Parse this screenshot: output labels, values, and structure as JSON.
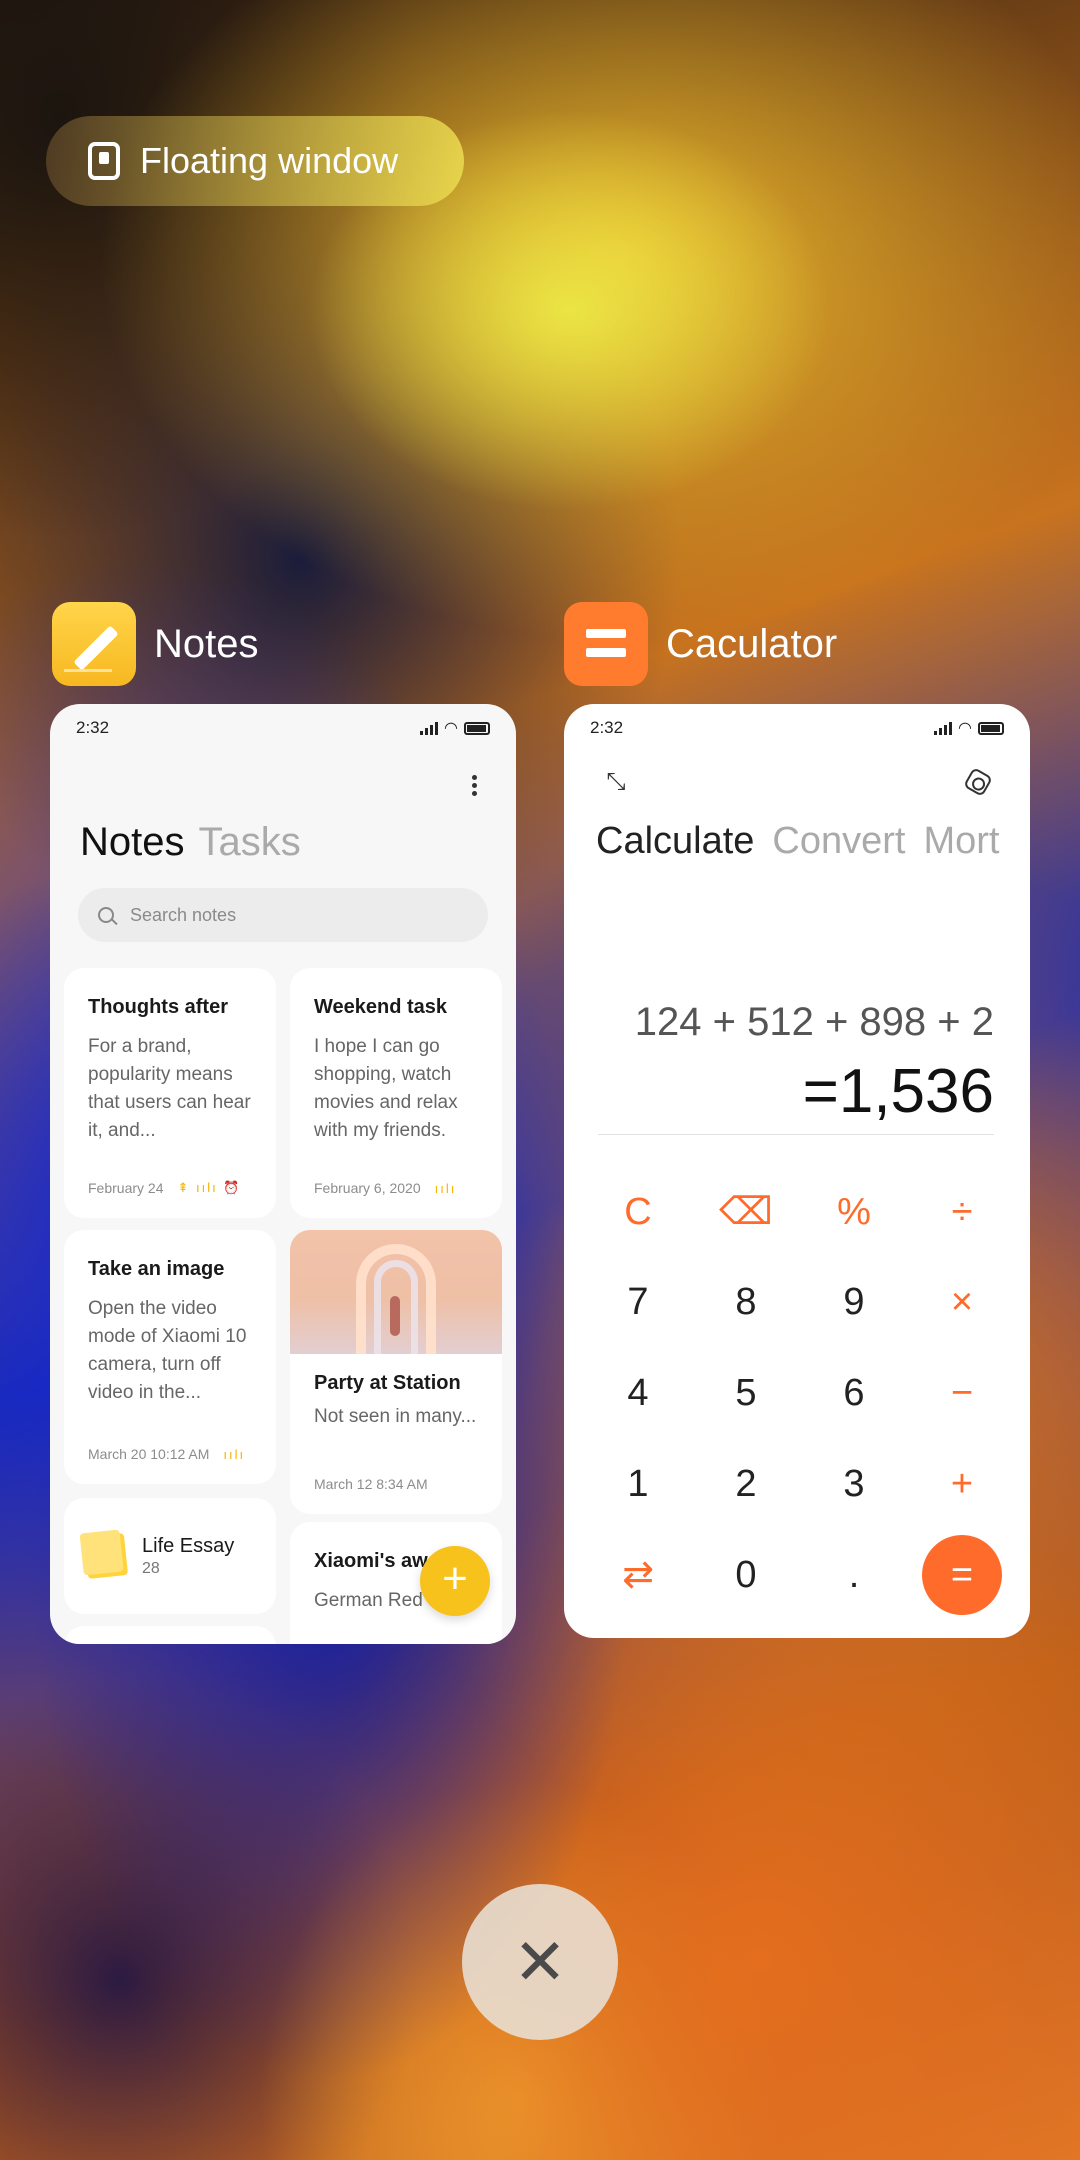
{
  "floating_window": {
    "label": "Floating window",
    "icon": "floating-window-icon"
  },
  "notes_app": {
    "name": "Notes",
    "icon": "notes-app-icon",
    "status_time": "2:32",
    "tabs": [
      "Notes",
      "Tasks"
    ],
    "search_placeholder": "Search notes",
    "notes": [
      {
        "title": "Thoughts after",
        "body": "For a brand, popularity means that users can hear it, and...",
        "date": "February 24"
      },
      {
        "title": "Weekend task",
        "body": "I hope I can go shopping, watch movies and relax with my friends.",
        "date": "February 6, 2020"
      },
      {
        "title": "Take an image",
        "body": "Open the video mode of Xiaomi 10 camera, turn off video in the...",
        "date": "March 20 10:12 AM"
      },
      {
        "title": "Party at Station",
        "body": "Not seen in many...",
        "date": "March 12 8:34 AM"
      },
      {
        "title": "Xiaomi's aw",
        "body": "German Red"
      }
    ],
    "folder": {
      "title": "Life Essay",
      "count": "28"
    },
    "fab_label": "+"
  },
  "calculator_app": {
    "name": "Caculator",
    "icon": "calculator-app-icon",
    "status_time": "2:32",
    "tabs": [
      "Calculate",
      "Convert",
      "Mort"
    ],
    "expression": "124 + 512 + 898 + 2",
    "result": "=1,536",
    "keys": {
      "clear": "C",
      "backspace": "⌫",
      "percent": "%",
      "divide": "÷",
      "seven": "7",
      "eight": "8",
      "nine": "9",
      "multiply": "×",
      "four": "4",
      "five": "5",
      "six": "6",
      "minus": "−",
      "one": "1",
      "two": "2",
      "three": "3",
      "plus": "+",
      "swap": "⇄",
      "zero": "0",
      "dot": ".",
      "equals": "="
    },
    "accent_color": "#ff6b2b"
  },
  "close_all": {
    "label": "✕",
    "icon": "close-icon"
  }
}
